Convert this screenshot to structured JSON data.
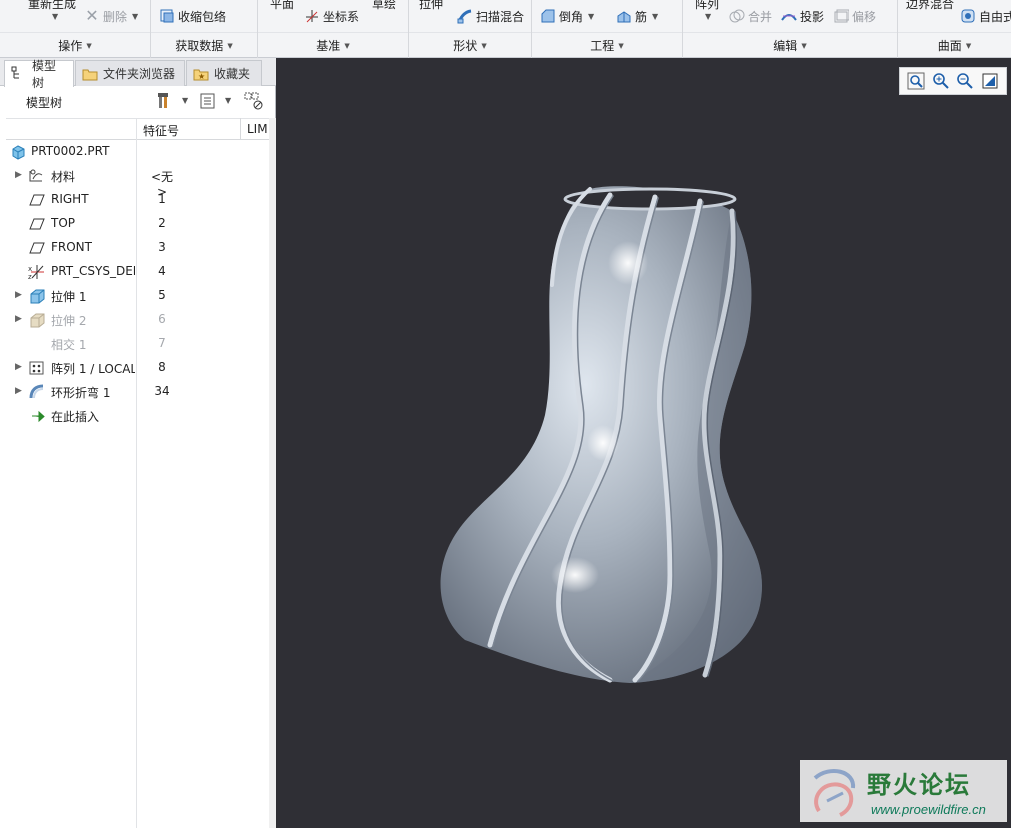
{
  "ribbon": {
    "groups": [
      {
        "id": "ops",
        "label": "操作",
        "cut_top": "重新生成",
        "buttons": [
          {
            "label": "删除",
            "disabled": true
          }
        ]
      },
      {
        "id": "getdata",
        "label": "获取数据",
        "buttons": [
          {
            "label": "收缩包络",
            "disabled": false
          }
        ]
      },
      {
        "id": "datum",
        "label": "基准",
        "cut_top": "平面",
        "cut_top2": "草绘",
        "buttons": [
          {
            "label": "坐标系",
            "disabled": false
          }
        ]
      },
      {
        "id": "shape",
        "label": "形状",
        "cut_top": "拉伸",
        "buttons": [
          {
            "label": "扫描混合",
            "disabled": false
          }
        ]
      },
      {
        "id": "eng",
        "label": "工程",
        "buttons": [
          {
            "label": "倒角",
            "disabled": false
          },
          {
            "label": "筋",
            "disabled": false
          }
        ]
      },
      {
        "id": "edit",
        "label": "编辑",
        "cut_top": "阵列",
        "buttons": [
          {
            "label": "合并",
            "disabled": true
          },
          {
            "label": "投影",
            "disabled": false
          },
          {
            "label": "偏移",
            "disabled": true
          }
        ]
      },
      {
        "id": "surface",
        "label": "曲面",
        "cut_top": "边界混合",
        "buttons": [
          {
            "label": "自由式",
            "disabled": false
          }
        ]
      }
    ]
  },
  "panel": {
    "tabs": [
      {
        "label": "模型树",
        "active": true
      },
      {
        "label": "文件夹浏览器",
        "active": false
      },
      {
        "label": "收藏夹",
        "active": false
      }
    ],
    "tree_title": "模型树",
    "columns": {
      "feature_id": "特征号",
      "extra": "LIM"
    },
    "root": "PRT0002.PRT",
    "rows": [
      {
        "name": "材料",
        "id": "<无>",
        "icon": "material",
        "expandable": true,
        "dim": false
      },
      {
        "name": "RIGHT",
        "id": "1",
        "icon": "plane",
        "expandable": false,
        "dim": false
      },
      {
        "name": "TOP",
        "id": "2",
        "icon": "plane",
        "expandable": false,
        "dim": false
      },
      {
        "name": "FRONT",
        "id": "3",
        "icon": "plane",
        "expandable": false,
        "dim": false
      },
      {
        "name": "PRT_CSYS_DEF",
        "id": "4",
        "icon": "csys",
        "expandable": false,
        "dim": false
      },
      {
        "name": "拉伸 1",
        "id": "5",
        "icon": "extrude",
        "expandable": true,
        "dim": false
      },
      {
        "name": "拉伸 2",
        "id": "6",
        "icon": "extrude",
        "expandable": true,
        "dim": true
      },
      {
        "name": "相交 1",
        "id": "7",
        "icon": "intersect",
        "expandable": false,
        "dim": true
      },
      {
        "name": "阵列 1 / LOCAL",
        "id": "8",
        "icon": "pattern",
        "expandable": true,
        "dim": false
      },
      {
        "name": "环形折弯 1",
        "id": "34",
        "icon": "bend",
        "expandable": true,
        "dim": false
      },
      {
        "name": "在此插入",
        "id": "",
        "icon": "insert",
        "expandable": false,
        "dim": false
      }
    ]
  },
  "colors": {
    "viewport_bg": "#2f2f35",
    "model": "#a9b3bf",
    "accent": "#2e7bd6"
  },
  "watermark": {
    "title": "野火论坛",
    "url": "www.proewildfire.cn"
  }
}
